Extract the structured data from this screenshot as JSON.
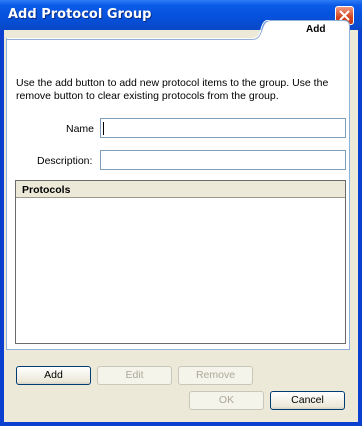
{
  "window": {
    "title": "Add Protocol Group"
  },
  "tab": {
    "label": "Add"
  },
  "description": "Use the add button to add new protocol items to the group.  Use the remove button to clear existing protocols from the group.",
  "form": {
    "name_label": "Name",
    "name_value": "",
    "description_label": "Description:",
    "description_value": ""
  },
  "protocols": {
    "header": "Protocols",
    "items": []
  },
  "buttons": {
    "add": "Add",
    "edit": "Edit",
    "remove": "Remove",
    "ok": "OK",
    "cancel": "Cancel"
  },
  "colors": {
    "titlebar": "#0551dd",
    "client_bg": "#ece9d8",
    "tab_border": "#8fb0d8",
    "close_button": "#d54520"
  }
}
